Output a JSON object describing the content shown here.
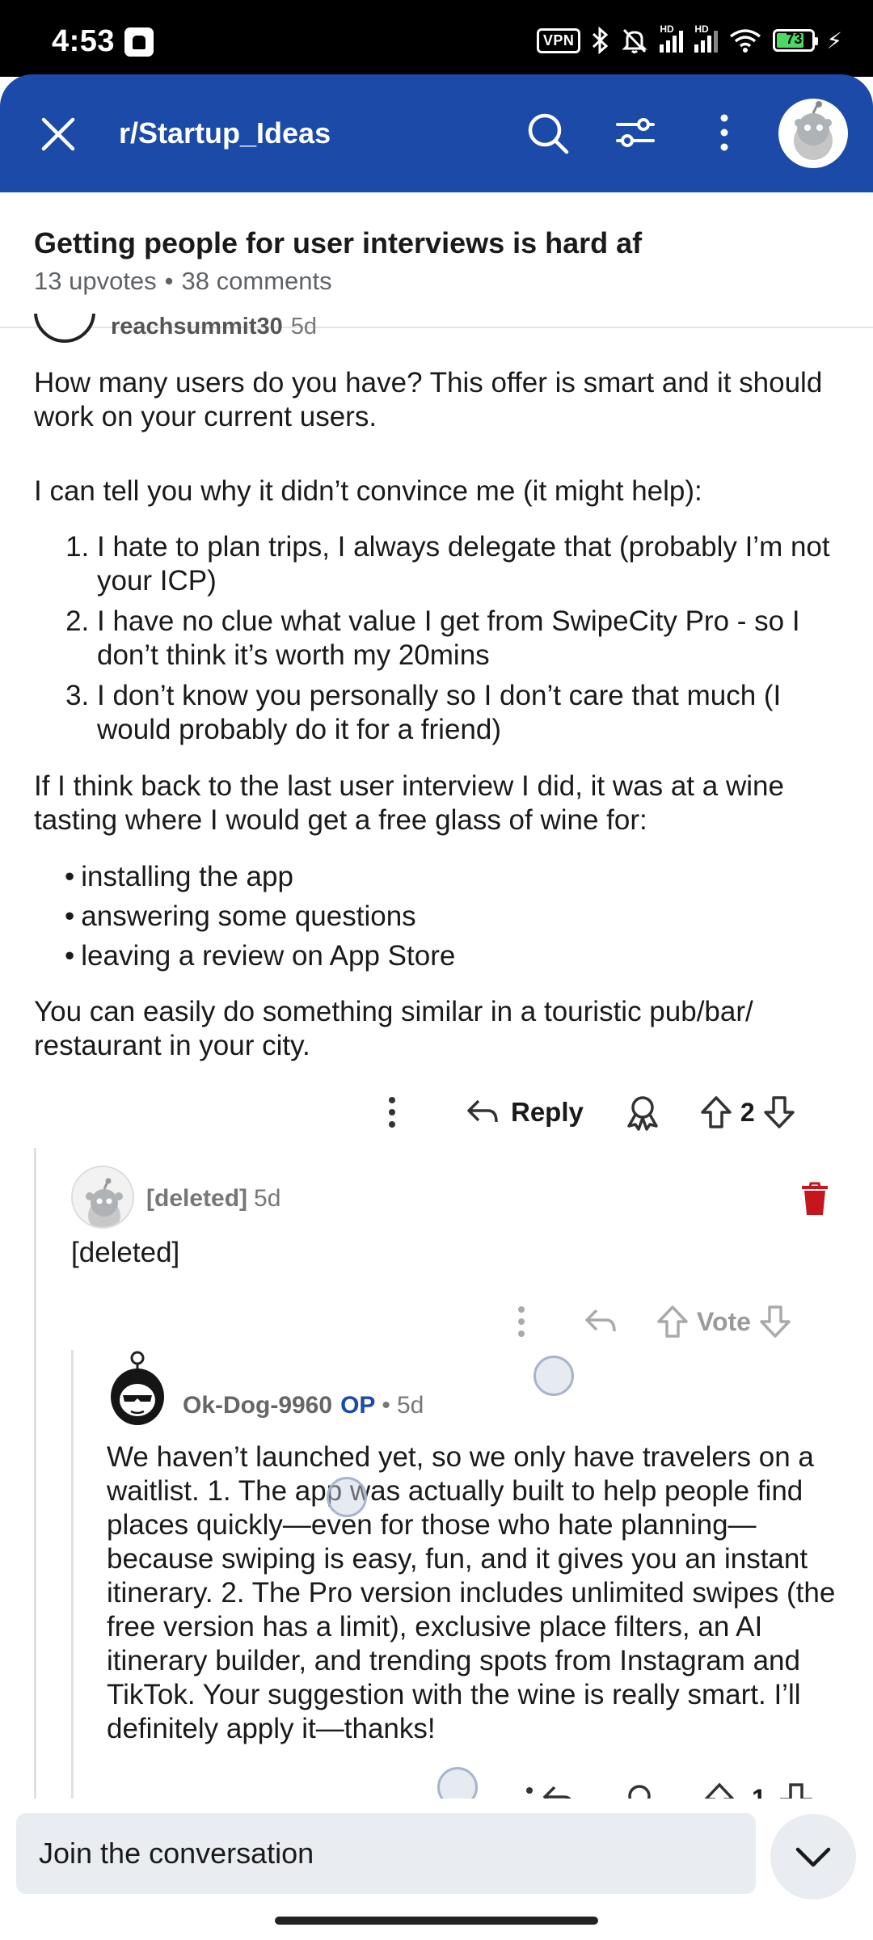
{
  "status_bar": {
    "time": "4:53",
    "vpn_label": "VPN",
    "signal_label": "HD",
    "battery": "73"
  },
  "header": {
    "subreddit": "r/Startup_Ideas",
    "accent_color": "#1c4aa8"
  },
  "post": {
    "title": "Getting people for user interviews is hard af",
    "upvotes": "13 upvotes",
    "separator": "•",
    "comments": "38 comments"
  },
  "comment1": {
    "username": "reachsummit30",
    "age": "5d",
    "paragraph1": "How many users do you have? This offer is smart and it should work on your current users.",
    "paragraph2": "I can tell you why it didn’t convince me (it might help):",
    "list": [
      "I hate to plan trips, I always delegate that (probably I’m not your ICP)",
      "I have no clue what value I get from SwipeCity Pro - so I don’t think it’s worth my 20mins",
      "I don’t know you personally so I don’t care that much (I would probably do it for a friend)"
    ],
    "paragraph3": "If I think back to the last user interview I did, it was at a wine tasting where I would get a free glass of wine for:",
    "bullets": [
      "installing the app",
      "answering some questions",
      "leaving a review on App Store"
    ],
    "paragraph4": "You can easily do something similar in a touristic pub/bar/ restaurant in your city.",
    "reply_label": "Reply",
    "vote_count": "2"
  },
  "comment2": {
    "username": "[deleted]",
    "age": "5d",
    "text": "[deleted]",
    "vote_label": "Vote",
    "trash_color": "#c4161c"
  },
  "comment3": {
    "username": "Ok-Dog-9960",
    "op_badge": "OP",
    "separator": "•",
    "age": "5d",
    "text": "We haven’t launched yet, so we only have travelers on a waitlist. 1.  The app was actually built to help people find places quickly—even for those who hate planning—because swiping is easy, fun, and it gives you an instant itinerary. 2. The Pro version includes unlimited swipes (the free version has a limit), exclusive place filters, an AI itinerary builder, and trending spots from Instagram and TikTok. Your suggestion with the wine is really smart. I’ll definitely apply it—thanks!",
    "vote_count": "1"
  },
  "bottom": {
    "join_placeholder": "Join the conversation"
  }
}
